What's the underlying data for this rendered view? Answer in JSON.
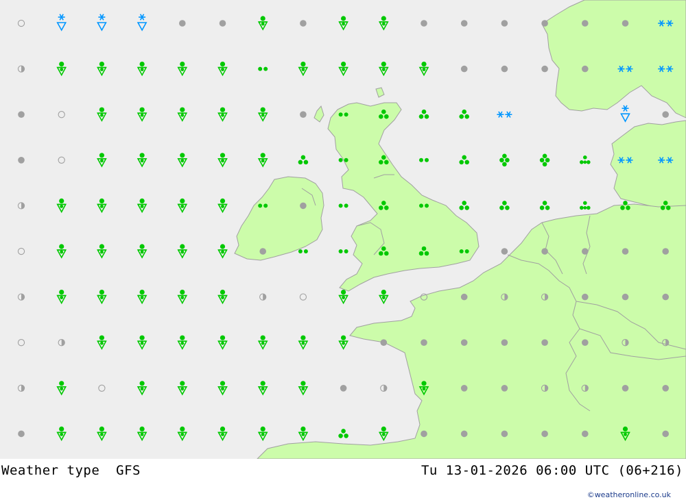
{
  "footer": {
    "title": "Weather type  GFS",
    "datetime": "Tu 13-01-2026 06:00 UTC (06+216)",
    "credit": "©weatheronline.co.uk"
  },
  "colors": {
    "sea": "#eeeeee",
    "land": "#ccfcaa",
    "border": "#a0a0a0",
    "rain": "#00c800",
    "snow": "#0096ff",
    "dry": "#a0a0a0"
  },
  "symbol_legend": {
    "rs": "rain shower",
    "ss": "snow shower",
    "dr": "drizzle",
    "ra": "rain",
    "hv": "rain heavy",
    "rh": "rain heavy (alt)",
    "sn": "snow",
    "ov": "overcast",
    "cl": "clear",
    "pc": "partly cloudy"
  },
  "weather_grid": [
    [
      "cl",
      "ss",
      "ss",
      "ss",
      "ov",
      "ov",
      "rs",
      "ov",
      "rs",
      "rs",
      "ov",
      "ov",
      "ov",
      "ov",
      "ov",
      "ov",
      "sn"
    ],
    [
      "pc",
      "rs",
      "rs",
      "rs",
      "rs",
      "rs",
      "dr",
      "rs",
      "rs",
      "rs",
      "rs",
      "ov",
      "ov",
      "ov",
      "ov",
      "sn",
      "sn"
    ],
    [
      "ov",
      "cl",
      "rs",
      "rs",
      "rs",
      "rs",
      "rs",
      "ov",
      "dr",
      "ra",
      "ra",
      "ra",
      "sn",
      "none",
      "none",
      "ss",
      "ov"
    ],
    [
      "ov",
      "cl",
      "rs",
      "rs",
      "rs",
      "rs",
      "rs",
      "ra",
      "dr",
      "ra",
      "dr",
      "ra",
      "hv",
      "hv",
      "rh",
      "sn",
      "sn"
    ],
    [
      "pc",
      "rs",
      "rs",
      "rs",
      "rs",
      "rs",
      "dr",
      "ov",
      "dr",
      "ra",
      "dr",
      "ra",
      "ra",
      "ra",
      "rh",
      "ra",
      "ra"
    ],
    [
      "cl",
      "rs",
      "rs",
      "rs",
      "rs",
      "rs",
      "ov",
      "dr",
      "dr",
      "ra",
      "ra",
      "dr",
      "ov",
      "ov",
      "ov",
      "ov",
      "ov"
    ],
    [
      "pc",
      "rs",
      "rs",
      "rs",
      "rs",
      "rs",
      "pc",
      "cl",
      "rs",
      "rs",
      "cl",
      "ov",
      "pc",
      "pc",
      "ov",
      "ov",
      "ov"
    ],
    [
      "cl",
      "pc",
      "rs",
      "rs",
      "rs",
      "rs",
      "rs",
      "rs",
      "rs",
      "ov",
      "ov",
      "ov",
      "ov",
      "ov",
      "ov",
      "pc",
      "pc"
    ],
    [
      "pc",
      "rs",
      "cl",
      "rs",
      "rs",
      "rs",
      "rs",
      "rs",
      "ov",
      "pc",
      "rs",
      "ov",
      "ov",
      "pc",
      "pc",
      "ov",
      "ov"
    ],
    [
      "ov",
      "rs",
      "rs",
      "rs",
      "rs",
      "rs",
      "rs",
      "rs",
      "ra",
      "rs",
      "ov",
      "ov",
      "ov",
      "ov",
      "ov",
      "rs",
      "ov"
    ]
  ]
}
